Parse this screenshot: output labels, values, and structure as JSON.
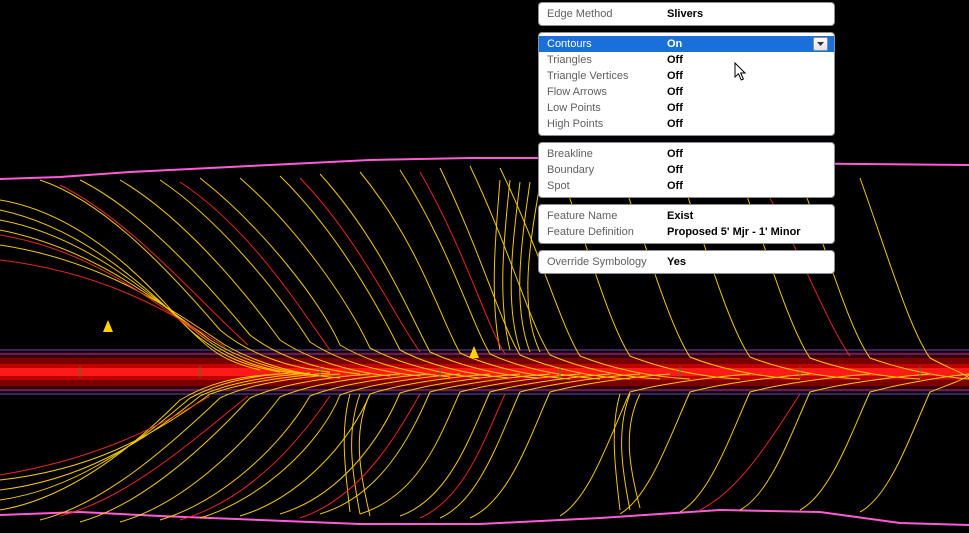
{
  "panel_edge": {
    "label": "Edge Method",
    "value": "Slivers"
  },
  "panel_display": {
    "rows": [
      {
        "label": "Contours",
        "value": "On",
        "selected": true,
        "dropdown": true
      },
      {
        "label": "Triangles",
        "value": "Off"
      },
      {
        "label": "Triangle Vertices",
        "value": "Off"
      },
      {
        "label": "Flow Arrows",
        "value": "Off"
      },
      {
        "label": "Low Points",
        "value": "Off"
      },
      {
        "label": "High Points",
        "value": "Off"
      }
    ]
  },
  "panel_breakline": {
    "rows": [
      {
        "label": "Breakline",
        "value": "Off"
      },
      {
        "label": "Boundary",
        "value": "Off"
      },
      {
        "label": "Spot",
        "value": "Off"
      }
    ]
  },
  "panel_feature": {
    "rows": [
      {
        "label": "Feature Name",
        "value": "Exist"
      },
      {
        "label": "Feature Definition",
        "value": "Proposed 5' Mjr - 1' Minor"
      }
    ]
  },
  "panel_override": {
    "label": "Override Symbology",
    "value": "Yes"
  }
}
